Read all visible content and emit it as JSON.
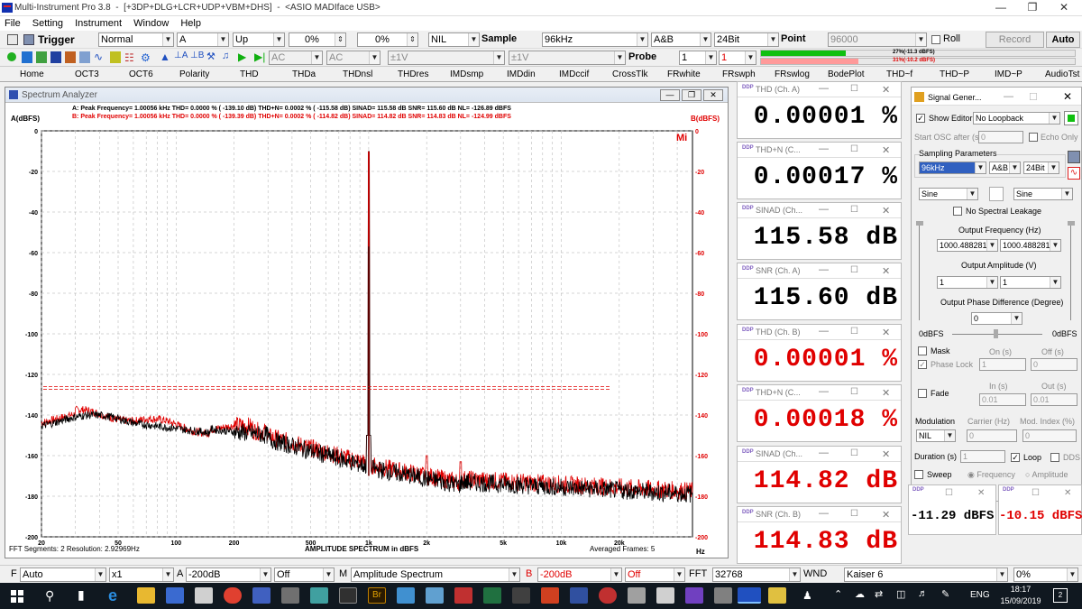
{
  "window": {
    "title": "Multi-Instrument Pro 3.8",
    "subtitle": "[+3DP+DLG+LCR+UDP+VBM+DHS]",
    "device": "<ASIO MADIface USB>"
  },
  "menu": [
    "File",
    "Setting",
    "Instrument",
    "Window",
    "Help"
  ],
  "toolbar1": {
    "trigger_label": "Trigger",
    "trigger_mode": "Normal",
    "channel": "A",
    "edge": "Up",
    "pct1": "0%",
    "pct2": "0%",
    "nil": "NIL",
    "sample_label": "Sample",
    "sample_rate": "96kHz",
    "channels": "A&B",
    "bits": "24Bit",
    "point_label": "Point",
    "points": "96000",
    "roll_label": "Roll",
    "record_label": "Record",
    "auto_label": "Auto"
  },
  "toolbar2": {
    "coupling_a": "AC",
    "coupling_b": "AC",
    "range_a": "±1V",
    "range_b": "±1V",
    "probe_label": "Probe",
    "probe_a": "1",
    "probe_b": "1",
    "level_a": "27%(-11.3 dBFS)",
    "level_b": "31%(-10.2 dBFS)"
  },
  "tabs": [
    "Home",
    "OCT3",
    "OCT6",
    "Polarity",
    "THD",
    "THDa",
    "THDnsl",
    "THDres",
    "IMDsmp",
    "IMDdin",
    "IMDccif",
    "CrossTlk",
    "FRwhite",
    "FRswph",
    "FRswlog",
    "BodePlot",
    "THD~f",
    "THD~P",
    "IMD~P",
    "AudioTst"
  ],
  "spectrum": {
    "window_title": "Spectrum Analyzer",
    "left_axis": "A(dBFS)",
    "right_axis": "B(dBFS)",
    "info_a": "A: Peak Frequency=     1.00056  kHz  THD=      0.0000 % ( -139.10 dB)  THD+N=      0.0002 % ( -115.58 dB)  SINAD=   115.58 dB  SNR=   115.60 dB  NL=  -126.89 dBFS",
    "info_b": "B: Peak Frequency=     1.00056  kHz  THD=      0.0000 % ( -139.39 dB)  THD+N=      0.0002 % ( -114.82 dB)  SINAD=   114.82 dB  SNR=   114.83 dB  NL=  -124.99 dBFS",
    "mi_logo": "Mi",
    "footer_left": "FFT Segments: 2    Resolution: 2.92969Hz",
    "footer_center": "AMPLITUDE  SPECTRUM in dBFS",
    "footer_right": "Averaged Frames: 5",
    "unit": "Hz"
  },
  "chart_data": {
    "type": "line",
    "x_scale": "log",
    "xlim": [
      20,
      48000
    ],
    "ylim": [
      -200,
      0
    ],
    "x_ticks": [
      "20",
      "50",
      "100",
      "200",
      "500",
      "1k",
      "2k",
      "5k",
      "10k",
      "20k"
    ],
    "y_ticks": [
      "0",
      "-20",
      "-40",
      "-60",
      "-80",
      "-100",
      "-120",
      "-140",
      "-160",
      "-180",
      "-200"
    ],
    "grid": true,
    "series": [
      {
        "channel": "A",
        "color": "#000000",
        "peak_hz": 1000.56,
        "peak_dbfs": -10.2
      },
      {
        "channel": "B",
        "color": "#e00000",
        "peak_hz": 1000.56,
        "peak_dbfs": -10.2,
        "reference_line_dbfs": -126
      }
    ]
  },
  "meters": [
    {
      "title": "THD (Ch. A)",
      "value": "0.00001 %",
      "color": "black"
    },
    {
      "title": "THD+N (C...",
      "value": "0.00017 %",
      "color": "black"
    },
    {
      "title": "SINAD (Ch...",
      "value": "115.58 dB",
      "color": "black"
    },
    {
      "title": "SNR (Ch. A)",
      "value": "115.60 dB",
      "color": "black"
    },
    {
      "title": "THD (Ch. B)",
      "value": "0.00001 %",
      "color": "red"
    },
    {
      "title": "THD+N (C...",
      "value": "0.00018 %",
      "color": "red"
    },
    {
      "title": "SINAD (Ch...",
      "value": "114.82 dB",
      "color": "red"
    },
    {
      "title": "SNR (Ch. B)",
      "value": "114.83 dB",
      "color": "red"
    }
  ],
  "small_meters": [
    {
      "value": "-11.29 dBFS",
      "color": "black"
    },
    {
      "value": "-10.15 dBFS",
      "color": "red"
    }
  ],
  "siggen": {
    "title": "Signal Gener...",
    "show_editor": "Show Editor",
    "loopback": "No Loopback",
    "start_osc": "Start OSC after (s)",
    "start_val": "0",
    "echo_only": "Echo Only",
    "sampling_params": "Sampling Parameters",
    "rate": "96kHz",
    "chan": "A&B",
    "bits": "24Bit",
    "wave_a": "Sine",
    "wave_b": "Sine",
    "no_leakage": "No Spectral Leakage",
    "out_freq": "Output Frequency (Hz)",
    "freq_a": "1000.488281",
    "freq_b": "1000.488281",
    "out_amp": "Output Amplitude (V)",
    "amp_a": "1",
    "amp_b": "1",
    "out_phase": "Output Phase Difference (Degree)",
    "phase": "0",
    "dbfs_left": "0dBFS",
    "dbfs_right": "0dBFS",
    "mask": "Mask",
    "on_s": "On (s)",
    "off_s": "Off (s)",
    "phase_lock": "Phase Lock",
    "phase_lock_val": "1",
    "off_val": "0",
    "fade": "Fade",
    "in_s": "In (s)",
    "out_s": "Out (s)",
    "in_val": "0.01",
    "out_val": "0.01",
    "modulation": "Modulation",
    "carrier": "Carrier (Hz)",
    "mod_index": "Mod. Index (%)",
    "mod_type": "NIL",
    "carrier_val": "0",
    "mod_val": "0",
    "duration": "Duration (s)",
    "duration_val": "1",
    "loop": "Loop",
    "dds": "DDS",
    "sweep": "Sweep",
    "frequency": "Frequency",
    "amplitude": "Amplitude"
  },
  "bottombar": {
    "f_label": "F",
    "f_mode": "Auto",
    "zoom": "x1",
    "a_label": "A",
    "a_ref": "-200dB",
    "a_off": "Off",
    "m_label": "M",
    "m_mode": "Amplitude Spectrum",
    "b_label": "B",
    "b_ref": "-200dB",
    "b_off": "Off",
    "fft_label": "FFT",
    "fft_size": "32768",
    "wnd_label": "WND",
    "window": "Kaiser 6",
    "pct": "0%"
  },
  "taskbar": {
    "lang": "ENG",
    "time": "18:17",
    "date": "15/09/2019",
    "notif": "2"
  }
}
